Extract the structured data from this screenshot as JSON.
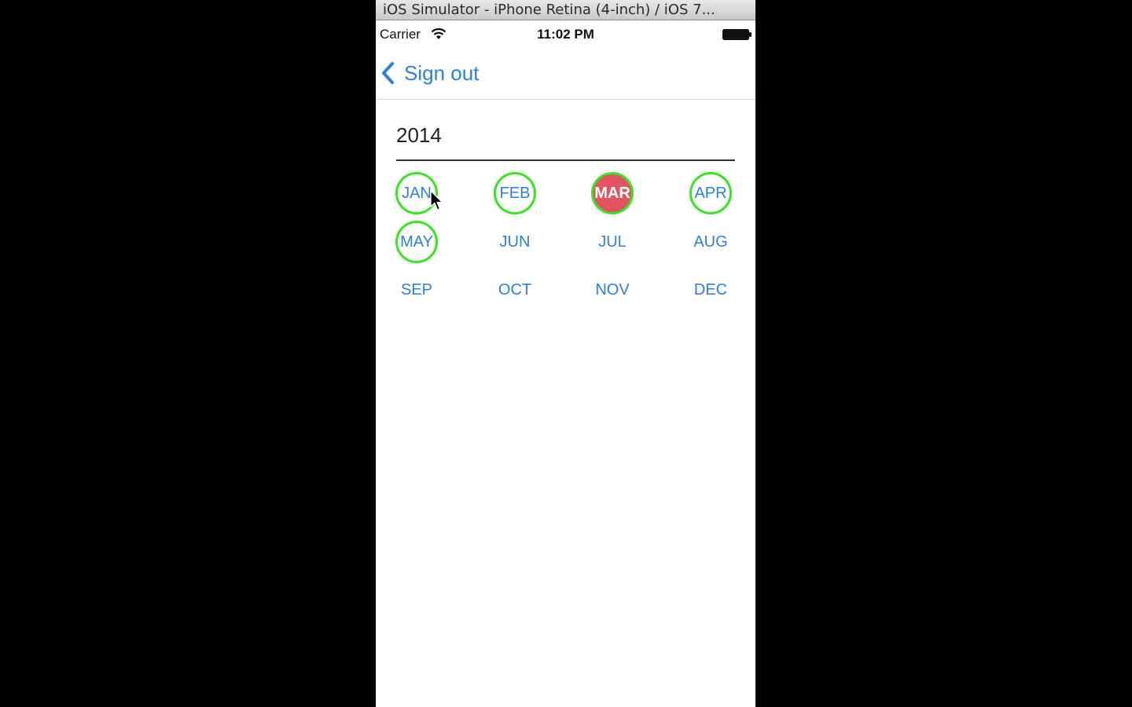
{
  "window": {
    "title": "iOS Simulator - iPhone Retina (4-inch) / iOS 7..."
  },
  "status_bar": {
    "carrier": "Carrier",
    "time": "11:02 PM",
    "icons": [
      "wifi-icon",
      "battery-icon"
    ]
  },
  "nav": {
    "back_label": "Sign out",
    "back_icon": "chevron-left-icon"
  },
  "calendar": {
    "year": "2014",
    "months": [
      {
        "label": "JAN",
        "state": "marked"
      },
      {
        "label": "FEB",
        "state": "marked"
      },
      {
        "label": "MAR",
        "state": "selected"
      },
      {
        "label": "APR",
        "state": "marked"
      },
      {
        "label": "MAY",
        "state": "marked"
      },
      {
        "label": "JUN",
        "state": "plain"
      },
      {
        "label": "JUL",
        "state": "plain"
      },
      {
        "label": "AUG",
        "state": "plain"
      },
      {
        "label": "SEP",
        "state": "plain"
      },
      {
        "label": "OCT",
        "state": "plain"
      },
      {
        "label": "NOV",
        "state": "plain"
      },
      {
        "label": "DEC",
        "state": "plain"
      }
    ]
  },
  "colors": {
    "accent": "#2b7fe0",
    "marked_ring": "#35e81d",
    "selected_fill": "#e0555f"
  }
}
